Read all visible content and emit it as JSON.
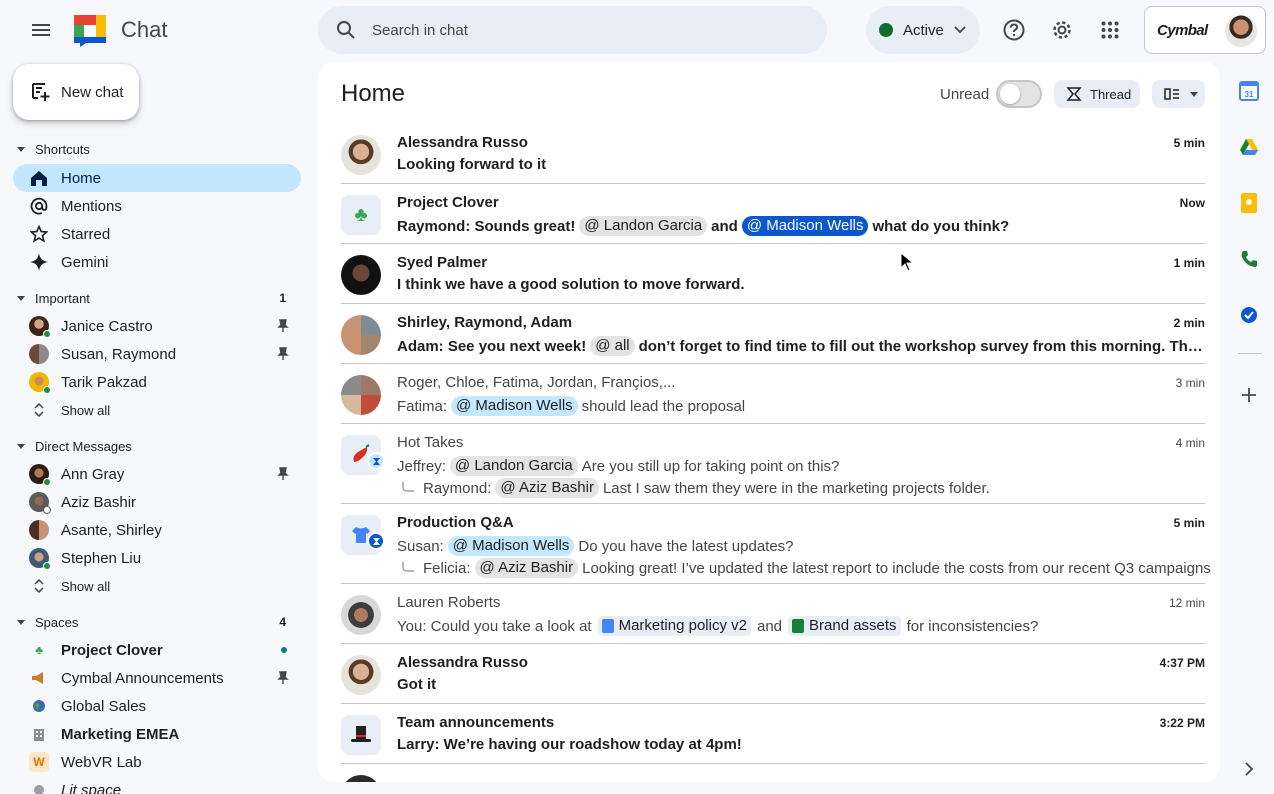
{
  "app": {
    "title": "Chat"
  },
  "search": {
    "placeholder": "Search in chat"
  },
  "status": {
    "label": "Active",
    "color": "#146c2e"
  },
  "account": {
    "org": "Cymbal"
  },
  "new_chat": {
    "label": "New chat"
  },
  "sidebar": {
    "shortcuts": {
      "label": "Shortcuts",
      "items": [
        {
          "label": "Home",
          "icon": "home-icon",
          "active": true
        },
        {
          "label": "Mentions",
          "icon": "at-icon"
        },
        {
          "label": "Starred",
          "icon": "star-icon"
        },
        {
          "label": "Gemini",
          "icon": "gemini-icon"
        }
      ]
    },
    "important": {
      "label": "Important",
      "count": "1",
      "items": [
        {
          "label": "Janice Castro"
        },
        {
          "label": "Susan, Raymond"
        },
        {
          "label": "Tarik Pakzad"
        },
        {
          "label": "Show all"
        }
      ]
    },
    "direct_messages": {
      "label": "Direct Messages",
      "items": [
        {
          "label": "Ann Gray"
        },
        {
          "label": "Aziz Bashir"
        },
        {
          "label": "Asante, Shirley"
        },
        {
          "label": "Stephen Liu"
        },
        {
          "label": "Show all"
        }
      ]
    },
    "spaces": {
      "label": "Spaces",
      "count": "4",
      "items": [
        {
          "label": "Project Clover"
        },
        {
          "label": "Cymbal Announcements"
        },
        {
          "label": "Global Sales"
        },
        {
          "label": "Marketing EMEA"
        },
        {
          "label": "WebVR Lab"
        },
        {
          "label": "Lit space"
        }
      ]
    }
  },
  "main": {
    "title": "Home",
    "unread_label": "Unread",
    "thread_label": "Thread",
    "rows": [
      {
        "name": "Alessandra Russo",
        "time": "5 min",
        "message": "Looking forward to it"
      },
      {
        "name": "Project Clover",
        "time": "Now",
        "prefix": "Raymond: Sounds great!",
        "mention1": "@ Landon Garcia",
        "mid": "and",
        "mention2": "@ Madison Wells",
        "suffix": "what do you think?"
      },
      {
        "name": "Syed Palmer",
        "time": "1 min",
        "message": "I think we have a good solution to move forward."
      },
      {
        "name": "Shirley, Raymond, Adam",
        "time": "2 min",
        "prefix": "Adam: See you next week!",
        "mention1": "@ all",
        "suffix": "don’t forget to find time to fill out the workshop survey from this morning. The EPU t..."
      },
      {
        "name": "Roger, Chloe, Fatima, Jordan, Françios,...",
        "time": "3 min",
        "prefix": "Fatima:",
        "mention1": "@ Madison Wells",
        "suffix": "should lead the proposal"
      },
      {
        "name": "Hot Takes",
        "time": "4 min",
        "prefix": "Jeffrey:",
        "mention1": "@ Landon Garcia",
        "suffix": "Are you still up for taking point on this?",
        "reply_prefix": "Raymond:",
        "reply_mention": "@ Aziz Bashir",
        "reply_suffix": "Last I saw them they were in the marketing projects folder."
      },
      {
        "name": "Production Q&A",
        "time": "5 min",
        "prefix": "Susan:",
        "mention1": "@ Madison Wells",
        "suffix": "Do you have the latest updates?",
        "reply_prefix": "Felicia:",
        "reply_mention": "@ Aziz Bashir",
        "reply_suffix": "Looking great! I’ve updated the latest report to include the costs from our recent Q3 campaigns"
      },
      {
        "name": "Lauren Roberts",
        "time": "12 min",
        "prefix": "You: Could you take a look at",
        "chip1": "Marketing policy v2",
        "mid": "and",
        "chip2": "Brand assets",
        "suffix": "for inconsistencies?"
      },
      {
        "name": "Alessandra Russo",
        "time": "4:37 PM",
        "message": "Got it"
      },
      {
        "name": "Team announcements",
        "time": "3:22 PM",
        "message": "Larry: We’re having our roadshow today at 4pm!"
      }
    ]
  }
}
